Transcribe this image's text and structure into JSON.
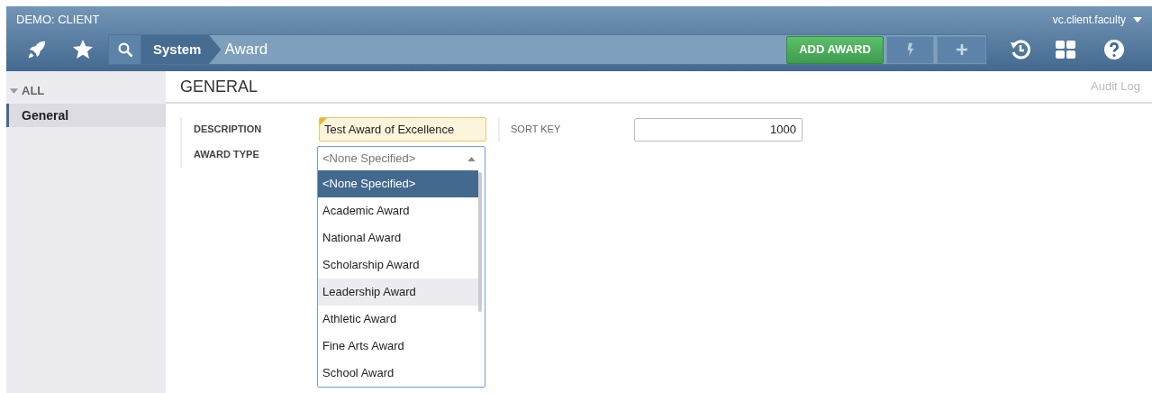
{
  "header": {
    "title": "DEMO: CLIENT",
    "user": "vc.client.faculty"
  },
  "breadcrumb": [
    {
      "label": "System",
      "kind": "segment"
    },
    {
      "label": "Award",
      "kind": "current"
    }
  ],
  "add_button": "ADD AWARD",
  "sidebar": {
    "group": {
      "label": "ALL",
      "expanded": true
    },
    "items": [
      {
        "label": "General",
        "selected": true
      }
    ]
  },
  "section": {
    "title": "GENERAL",
    "audit_link": "Audit Log"
  },
  "fields": {
    "description": {
      "label": "DESCRIPTION",
      "value": "Test Award of Excellence",
      "required": true
    },
    "award_type": {
      "label": "AWARD TYPE",
      "value": "<None Specified>",
      "expanded": true
    },
    "sort_key": {
      "label": "SORT KEY",
      "value": "1000"
    }
  },
  "options": [
    {
      "label": "<None Specified>",
      "selected": true,
      "hovered": false
    },
    {
      "label": "Academic Award",
      "selected": false,
      "hovered": false
    },
    {
      "label": "National Award",
      "selected": false,
      "hovered": false
    },
    {
      "label": "Scholarship Award",
      "selected": false,
      "hovered": false
    },
    {
      "label": "Leadership Award",
      "selected": false,
      "hovered": true
    },
    {
      "label": "Athletic Award",
      "selected": false,
      "hovered": false
    },
    {
      "label": "Fine Arts Award",
      "selected": false,
      "hovered": false
    },
    {
      "label": "School Award",
      "selected": false,
      "hovered": false
    }
  ]
}
